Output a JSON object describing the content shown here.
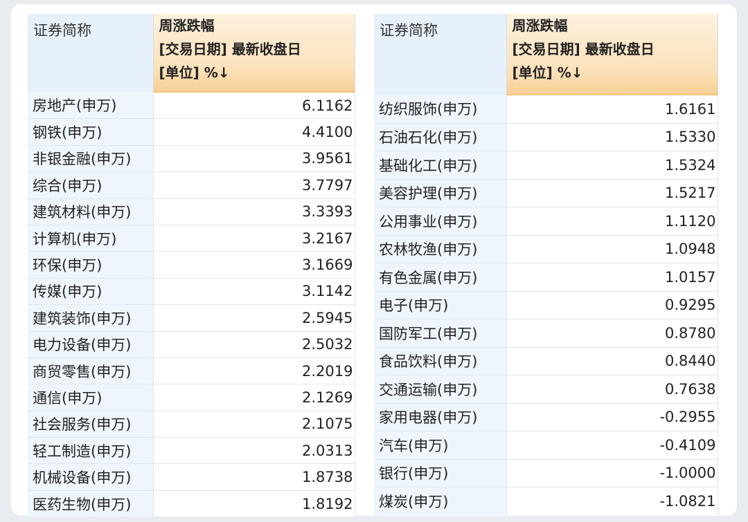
{
  "left_table": {
    "header": {
      "name_col": "证券简称",
      "value_col_lines": [
        "周涨跌幅",
        "[交易日期] 最新收盘日",
        "[单位] %↓"
      ]
    },
    "rows": [
      {
        "name": "房地产(申万)",
        "value": "6.1162"
      },
      {
        "name": "钢铁(申万)",
        "value": "4.4100"
      },
      {
        "name": "非银金融(申万)",
        "value": "3.9561"
      },
      {
        "name": "综合(申万)",
        "value": "3.7797"
      },
      {
        "name": "建筑材料(申万)",
        "value": "3.3393"
      },
      {
        "name": "计算机(申万)",
        "value": "3.2167"
      },
      {
        "name": "环保(申万)",
        "value": "3.1669"
      },
      {
        "name": "传媒(申万)",
        "value": "3.1142"
      },
      {
        "name": "建筑装饰(申万)",
        "value": "2.5945"
      },
      {
        "name": "电力设备(申万)",
        "value": "2.5032"
      },
      {
        "name": "商贸零售(申万)",
        "value": "2.2019"
      },
      {
        "name": "通信(申万)",
        "value": "2.1269"
      },
      {
        "name": "社会服务(申万)",
        "value": "2.1075"
      },
      {
        "name": "轻工制造(申万)",
        "value": "2.0313"
      },
      {
        "name": "机械设备(申万)",
        "value": "1.8738"
      },
      {
        "name": "医药生物(申万)",
        "value": "1.8192"
      }
    ]
  },
  "right_table": {
    "header": {
      "name_col": "证券简称",
      "value_col_lines": [
        "周涨跌幅",
        "[交易日期] 最新收盘日",
        "[单位] %↓"
      ]
    },
    "rows": [
      {
        "name": "纺织服饰(申万)",
        "value": "1.6161"
      },
      {
        "name": "石油石化(申万)",
        "value": "1.5330"
      },
      {
        "name": "基础化工(申万)",
        "value": "1.5324"
      },
      {
        "name": "美容护理(申万)",
        "value": "1.5217"
      },
      {
        "name": "公用事业(申万)",
        "value": "1.1120"
      },
      {
        "name": "农林牧渔(申万)",
        "value": "1.0948"
      },
      {
        "name": "有色金属(申万)",
        "value": "1.0157"
      },
      {
        "name": "电子(申万)",
        "value": "0.9295"
      },
      {
        "name": "国防军工(申万)",
        "value": "0.8780"
      },
      {
        "name": "食品饮料(申万)",
        "value": "0.8440"
      },
      {
        "name": "交通运输(申万)",
        "value": "0.7638"
      },
      {
        "name": "家用电器(申万)",
        "value": "-0.2955"
      },
      {
        "name": "汽车(申万)",
        "value": "-0.4109"
      },
      {
        "name": "银行(申万)",
        "value": "-1.0000"
      },
      {
        "name": "煤炭(申万)",
        "value": "-1.0821"
      }
    ]
  }
}
